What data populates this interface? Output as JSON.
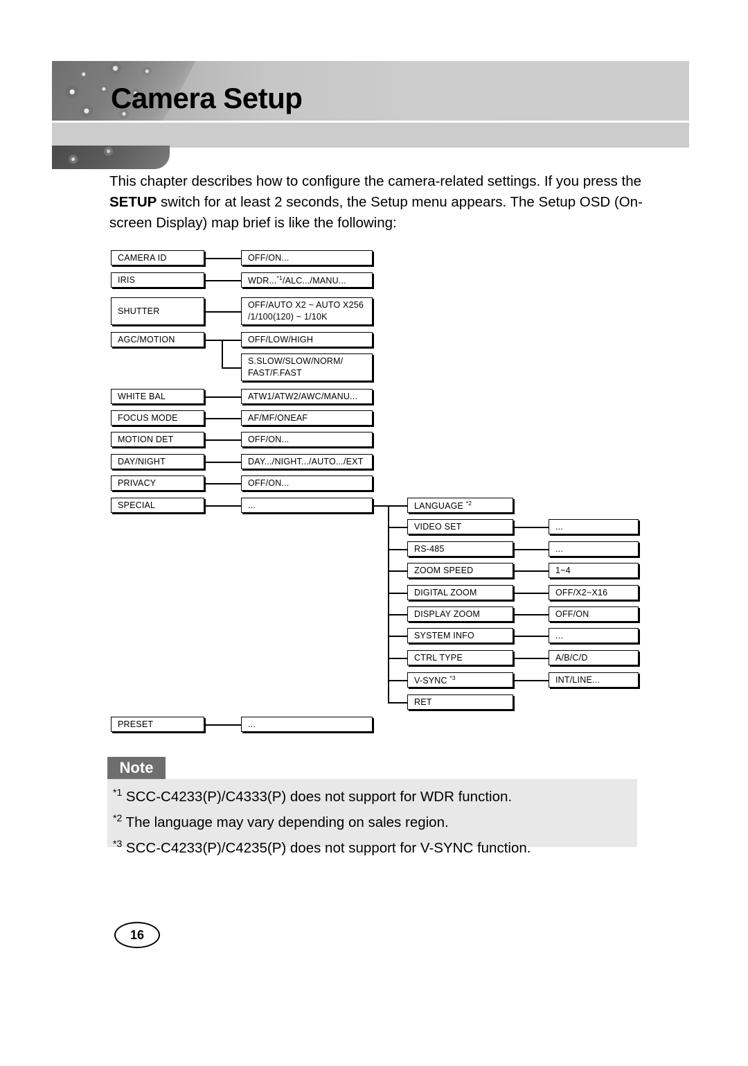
{
  "header": {
    "title": "Camera Setup"
  },
  "intro": {
    "line1_a": "This chapter describes how to configure the camera-related settings. If you",
    "line2_a": "press the ",
    "line2_b": "SETUP",
    "line2_c": " switch for at least 2 seconds, the Setup menu appears.",
    "line3_a": "The Setup OSD (On-screen Display) map brief is like the following:"
  },
  "diagram": {
    "col1": [
      {
        "label": "CAMERA ID"
      },
      {
        "label": "IRIS"
      },
      {
        "label": "SHUTTER"
      },
      {
        "label": "AGC/MOTION"
      },
      {
        "label": "WHITE BAL"
      },
      {
        "label": "FOCUS MODE"
      },
      {
        "label": "MOTION DET"
      },
      {
        "label": "DAY/NIGHT"
      },
      {
        "label": "PRIVACY"
      },
      {
        "label": "SPECIAL"
      },
      {
        "label": "PRESET"
      }
    ],
    "col2": [
      {
        "label": "OFF/ON..."
      },
      {
        "label": "WDR...*1/ALC.../MANU..."
      },
      {
        "label": "OFF/AUTO X2 ~ AUTO X256",
        "label2": "/1/100(120) ~ 1/10K"
      },
      {
        "label": "OFF/LOW/HIGH"
      },
      {
        "label": "S.SLOW/SLOW/NORM/",
        "label2": "FAST/F.FAST"
      },
      {
        "label": "ATW1/ATW2/AWC/MANU..."
      },
      {
        "label": "AF/MF/ONEAF"
      },
      {
        "label": "OFF/ON..."
      },
      {
        "label": "DAY.../NIGHT.../AUTO.../EXT"
      },
      {
        "label": "OFF/ON..."
      },
      {
        "label": "..."
      },
      {
        "label": "..."
      }
    ],
    "col3": [
      {
        "label": "LANGUAGE *2"
      },
      {
        "label": "VIDEO SET"
      },
      {
        "label": "RS-485"
      },
      {
        "label": "ZOOM SPEED"
      },
      {
        "label": "DIGITAL ZOOM"
      },
      {
        "label": "DISPLAY ZOOM"
      },
      {
        "label": "SYSTEM INFO"
      },
      {
        "label": "CTRL TYPE"
      },
      {
        "label": "V-SYNC *3"
      },
      {
        "label": "RET"
      }
    ],
    "col4": [
      {
        "label": "..."
      },
      {
        "label": "..."
      },
      {
        "label": "1~4"
      },
      {
        "label": "OFF/X2~X16"
      },
      {
        "label": "OFF/ON"
      },
      {
        "label": "..."
      },
      {
        "label": "A/B/C/D"
      },
      {
        "label": "INT/LINE..."
      }
    ]
  },
  "note": {
    "tab_label": "Note",
    "lines": [
      {
        "marker": "*1",
        "text": " SCC-C4233(P)/C4333(P) does not support for WDR function."
      },
      {
        "marker": "*2",
        "text": " The language may vary depending on sales region."
      },
      {
        "marker": "*3",
        "text": " SCC-C4233(P)/C4235(P) does not support for V-SYNC function."
      }
    ]
  },
  "footer": {
    "page_number": "16"
  }
}
